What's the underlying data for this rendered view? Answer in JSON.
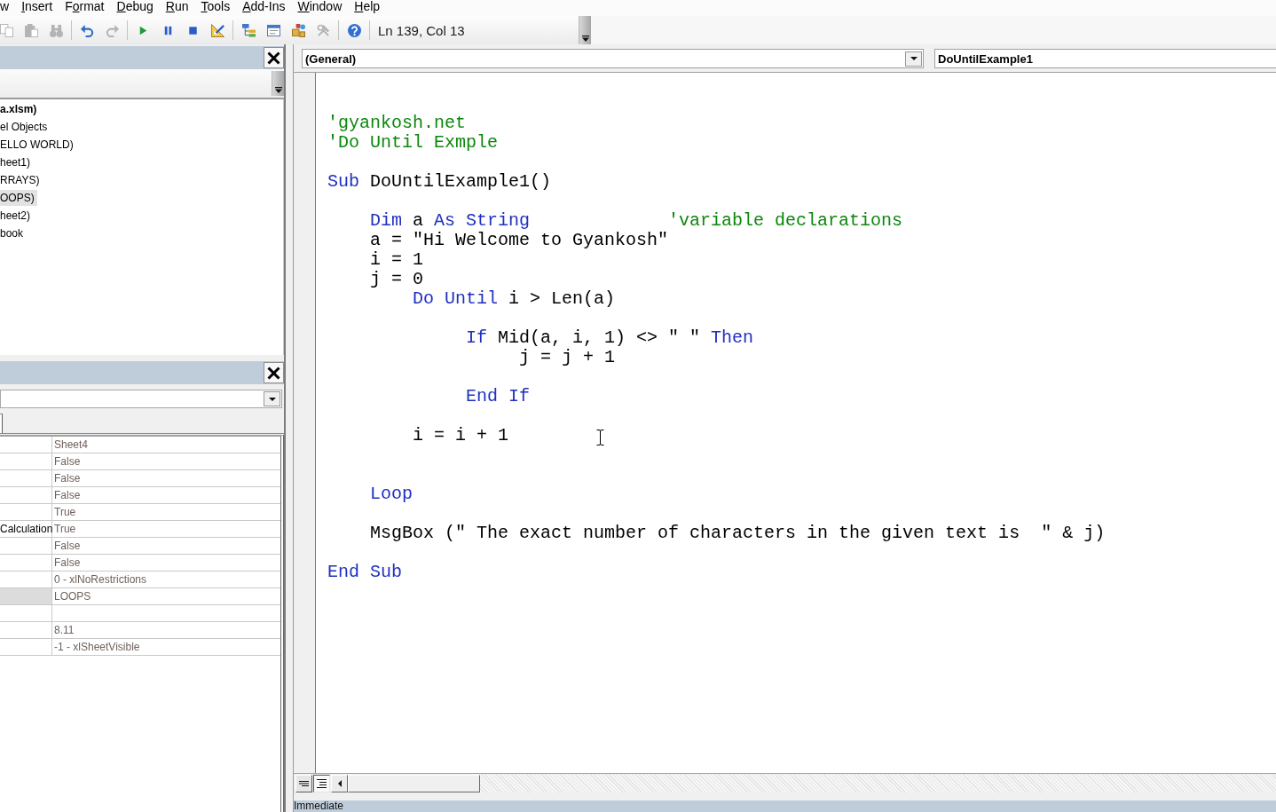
{
  "menu_bar": {
    "items": [
      {
        "label": "w",
        "underline_first": false
      },
      {
        "label": "Insert",
        "underline_first": true
      },
      {
        "label": "Format",
        "underline_first": false,
        "underline_second": true
      },
      {
        "label": "Debug",
        "underline_first": true
      },
      {
        "label": "Run",
        "underline_first": true
      },
      {
        "label": "Tools",
        "underline_first": true
      },
      {
        "label": "Add-Ins",
        "underline_first": true
      },
      {
        "label": "Window",
        "underline_first": true
      },
      {
        "label": "Help",
        "underline_first": true
      }
    ]
  },
  "toolbar": {
    "buttons": [
      {
        "kind": "copy",
        "disabled": true
      },
      {
        "kind": "paste",
        "disabled": true
      },
      {
        "kind": "find",
        "disabled": true
      },
      {
        "kind": "separator"
      },
      {
        "kind": "undo",
        "disabled": false
      },
      {
        "kind": "redo",
        "disabled": true
      },
      {
        "kind": "separator"
      },
      {
        "kind": "run",
        "disabled": false
      },
      {
        "kind": "break",
        "disabled": false
      },
      {
        "kind": "reset",
        "disabled": false
      },
      {
        "kind": "design_mode",
        "disabled": false
      },
      {
        "kind": "separator"
      },
      {
        "kind": "project_explorer",
        "disabled": false
      },
      {
        "kind": "properties",
        "disabled": false
      },
      {
        "kind": "object_browser",
        "disabled": false
      },
      {
        "kind": "toolbox",
        "disabled": true
      },
      {
        "kind": "separator"
      },
      {
        "kind": "help",
        "disabled": false
      },
      {
        "kind": "separator"
      }
    ],
    "cursor_position": "Ln 139, Col 13"
  },
  "project_explorer": {
    "tree": [
      {
        "label": "a.xlsm)",
        "selected": false,
        "children": [
          {
            "label": "el Objects",
            "selected": false,
            "children": [
              {
                "label": "ELLO WORLD)",
                "selected": false
              },
              {
                "label": "heet1)",
                "selected": false
              },
              {
                "label": "RRAYS)",
                "selected": false
              },
              {
                "label": "OOPS)",
                "selected": true
              },
              {
                "label": "heet2)",
                "selected": false
              },
              {
                "label": "book",
                "selected": false
              }
            ]
          }
        ]
      }
    ]
  },
  "properties": {
    "rows": [
      {
        "value": "Sheet4",
        "selected": false
      },
      {
        "value": "False",
        "selected": false
      },
      {
        "value": "False",
        "selected": false
      },
      {
        "value": "False",
        "selected": false
      },
      {
        "value": "True",
        "selected": false
      },
      {
        "name": "Calculation",
        "value": "True",
        "selected": false
      },
      {
        "value": "False",
        "selected": false
      },
      {
        "value": "False",
        "selected": false
      },
      {
        "value": "0 - xlNoRestrictions",
        "selected": false
      },
      {
        "value": "LOOPS",
        "selected": true
      },
      {
        "selected": false
      },
      {
        "value": "8.11",
        "selected": false
      },
      {
        "value": "-1 - xlSheetVisible",
        "selected": false
      }
    ]
  },
  "code_window": {
    "object_box": "(General)",
    "procedure_box": "DoUntilExample1",
    "lines": [
      {
        "kind": "blank"
      },
      {
        "kind": "blank"
      },
      {
        "kind": "code",
        "segments": [
          {
            "kind": "comment",
            "text": "'gyankosh.net"
          }
        ]
      },
      {
        "kind": "code",
        "segments": [
          {
            "kind": "comment",
            "text": "'Do Until Exmple"
          }
        ]
      },
      {
        "kind": "blank"
      },
      {
        "kind": "code",
        "segments": [
          {
            "kind": "keyword",
            "text": "Sub"
          },
          {
            "kind": "plain",
            "text": " DoUntilExample1()"
          }
        ]
      },
      {
        "kind": "blank"
      },
      {
        "kind": "code",
        "segments": [
          {
            "kind": "keyword",
            "text": "    Dim"
          },
          {
            "kind": "plain",
            "text": " a "
          },
          {
            "kind": "keyword",
            "text": "As String             "
          },
          {
            "kind": "comment",
            "text": "'variable declarations"
          }
        ]
      },
      {
        "kind": "code",
        "segments": [
          {
            "kind": "plain",
            "text": "    a = \"Hi Welcome to Gyankosh\""
          }
        ]
      },
      {
        "kind": "code",
        "segments": [
          {
            "kind": "plain",
            "text": "    i = 1"
          }
        ]
      },
      {
        "kind": "code",
        "segments": [
          {
            "kind": "plain",
            "text": "    j = 0"
          }
        ]
      },
      {
        "kind": "code",
        "segments": [
          {
            "kind": "keyword",
            "text": "        Do Until"
          },
          {
            "kind": "plain",
            "text": " i > Len(a)"
          }
        ]
      },
      {
        "kind": "blank"
      },
      {
        "kind": "code",
        "segments": [
          {
            "kind": "keyword",
            "text": "             If"
          },
          {
            "kind": "plain",
            "text": " Mid(a, i, 1) <> \" \" "
          },
          {
            "kind": "keyword",
            "text": "Then"
          }
        ]
      },
      {
        "kind": "code",
        "segments": [
          {
            "kind": "plain",
            "text": "                  j = j + 1"
          }
        ]
      },
      {
        "kind": "blank"
      },
      {
        "kind": "code",
        "segments": [
          {
            "kind": "keyword",
            "text": "             End If"
          }
        ]
      },
      {
        "kind": "blank"
      },
      {
        "kind": "code",
        "segments": [
          {
            "kind": "plain",
            "text": "        i = i + 1"
          }
        ]
      },
      {
        "kind": "blank"
      },
      {
        "kind": "blank"
      },
      {
        "kind": "code",
        "segments": [
          {
            "kind": "keyword",
            "text": "    Loop"
          }
        ]
      },
      {
        "kind": "blank"
      },
      {
        "kind": "code",
        "segments": [
          {
            "kind": "plain",
            "text": "    MsgBox (\" The exact number of characters in the given text is  \" & j)"
          }
        ]
      },
      {
        "kind": "blank"
      },
      {
        "kind": "code",
        "segments": [
          {
            "kind": "keyword",
            "text": "End Sub"
          }
        ]
      }
    ],
    "views": [
      {
        "kind": "procedure",
        "selected": false
      },
      {
        "kind": "full_module",
        "selected": true
      }
    ]
  },
  "immediate": {
    "title": "Immediate"
  }
}
